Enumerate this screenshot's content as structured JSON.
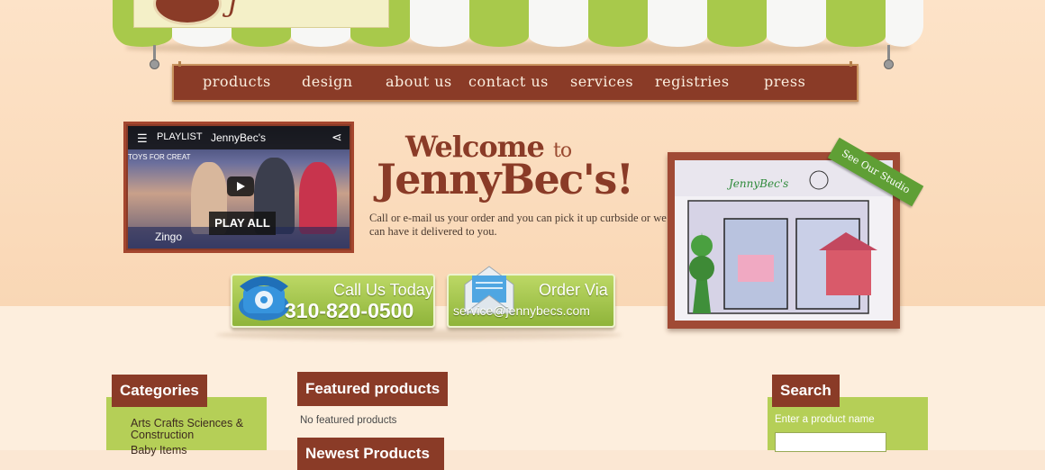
{
  "awning_colors": {
    "green": "#a8c94b",
    "white": "#f7f7f5"
  },
  "nav": {
    "items": [
      "products",
      "design",
      "about us",
      "contact us",
      "services",
      "registries",
      "press"
    ]
  },
  "video": {
    "playlist_label": "PLAYLIST",
    "channel": "JennyBec's",
    "play_all": "PLAY ALL",
    "overlay_text": "Zingo",
    "toys_text": "TOYS FOR CREAT",
    "icons": [
      "playlist-icon",
      "share-icon",
      "play-icon"
    ]
  },
  "welcome": {
    "word": "Welcome",
    "to": "to",
    "name": "JennyBec's!",
    "intro": "Call or e-mail us your order and you can pick it up curbside or we can have it delivered to you."
  },
  "studio": {
    "banner": "See Our Studio"
  },
  "call_button": {
    "title": "Call Us Today",
    "phone": "310-820-0500"
  },
  "order_button": {
    "title": "Order Via",
    "email": "service@jennybecs.com"
  },
  "categories": {
    "title": "Categories",
    "items": [
      "Arts Crafts Sciences & Construction",
      "Baby Items"
    ]
  },
  "featured": {
    "title": "Featured products",
    "empty": "No featured products",
    "second_title": "Newest Products"
  },
  "search": {
    "title": "Search",
    "label": "Enter a product name",
    "value": ""
  },
  "colors": {
    "brand_brown": "#8a3b27",
    "accent_green": "#b5cf57"
  }
}
